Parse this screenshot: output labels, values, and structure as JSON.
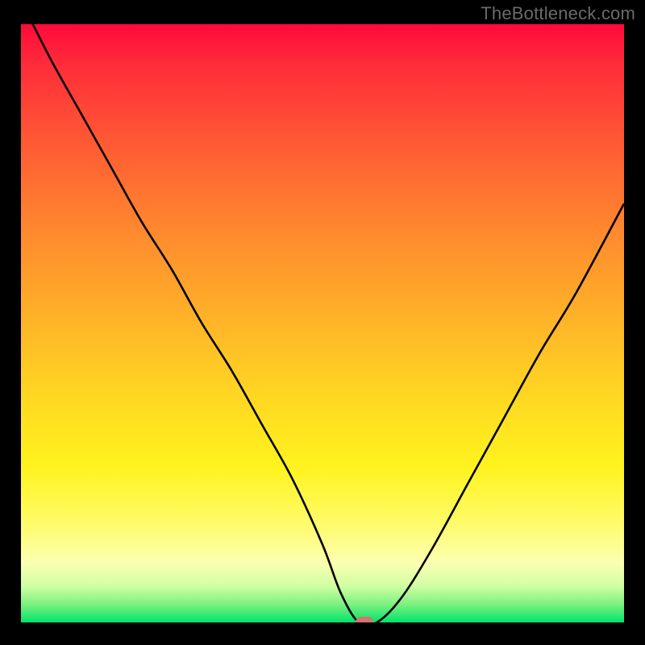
{
  "watermark": "TheBottleneck.com",
  "colors": {
    "frame_background": "#000000",
    "curve_stroke": "#000000",
    "marker_fill": "#d6726f",
    "watermark_color": "#6a6a6a",
    "gradient_stops": [
      "#ff0a3a",
      "#ff5a34",
      "#ffb528",
      "#fff31e",
      "#fbffb1",
      "#00e36c"
    ]
  },
  "chart_data": {
    "type": "line",
    "title": "",
    "xlabel": "",
    "ylabel": "",
    "x_range": [
      0,
      100
    ],
    "y_range": [
      0,
      100
    ],
    "axes_visible": false,
    "grid": false,
    "description": "Bottleneck percentage curve. Y≈100 is severe (red), Y≈0 is balanced (green). The curve dips to near 0 at the optimum x, with steeper rise on the right side.",
    "series": [
      {
        "name": "bottleneck-curve",
        "x": [
          0,
          5,
          10,
          15,
          20,
          25,
          30,
          35,
          40,
          45,
          50,
          53,
          56,
          59,
          63,
          68,
          74,
          80,
          86,
          92,
          100
        ],
        "y": [
          104,
          94,
          85,
          76,
          67,
          59,
          50,
          42,
          33,
          24,
          13,
          5,
          0,
          0,
          4,
          12,
          23,
          34,
          45,
          55,
          70
        ]
      }
    ],
    "annotations": [
      {
        "name": "optimum-marker",
        "x": 57,
        "y": 0,
        "shape": "rounded-rect",
        "color": "#d6726f"
      }
    ],
    "background_heatmap": {
      "mapping": "y-value → color",
      "stops": [
        [
          0,
          "#00e36c"
        ],
        [
          25,
          "#fff31e"
        ],
        [
          60,
          "#ff8a2e"
        ],
        [
          100,
          "#ff0a3a"
        ]
      ]
    },
    "legend": false
  }
}
